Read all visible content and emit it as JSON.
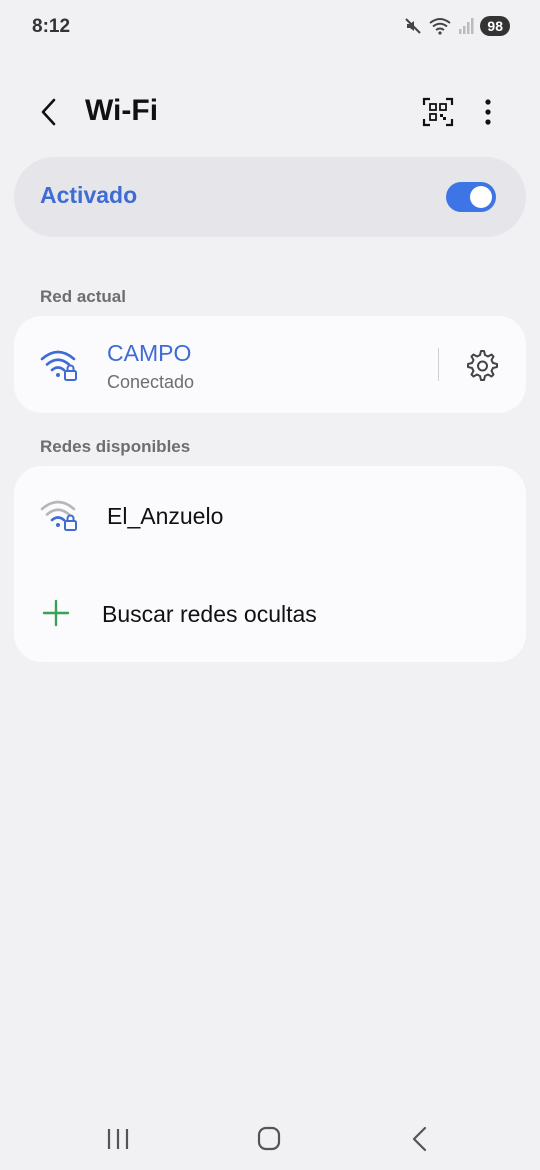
{
  "status_bar": {
    "time": "8:12",
    "battery": "98",
    "icons": [
      "mute-icon",
      "wifi-icon",
      "signal-icon",
      "battery-icon"
    ]
  },
  "header": {
    "title": "Wi-Fi",
    "icons": [
      "back-arrow-icon",
      "qr-code-icon",
      "more-options-icon"
    ]
  },
  "master_toggle": {
    "label": "Activado",
    "on": true
  },
  "current_network": {
    "section_label": "Red actual",
    "name": "CAMPO",
    "status": "Conectado",
    "icons": [
      "wifi-lock-icon",
      "gear-icon"
    ]
  },
  "available_networks": {
    "section_label": "Redes disponibles",
    "items": [
      {
        "name": "El_Anzuelo",
        "icon": "wifi-lock-icon"
      }
    ],
    "add_hidden_label": "Buscar redes ocultas"
  },
  "nav_bar": {
    "icons": [
      "recent-apps-icon",
      "home-icon",
      "back-icon"
    ]
  },
  "colors": {
    "accent": "#3e6cd4",
    "switch_on": "#3e75e6",
    "background": "#f1f1f4",
    "card": "#fbfbfd",
    "plus": "#3aa055"
  }
}
